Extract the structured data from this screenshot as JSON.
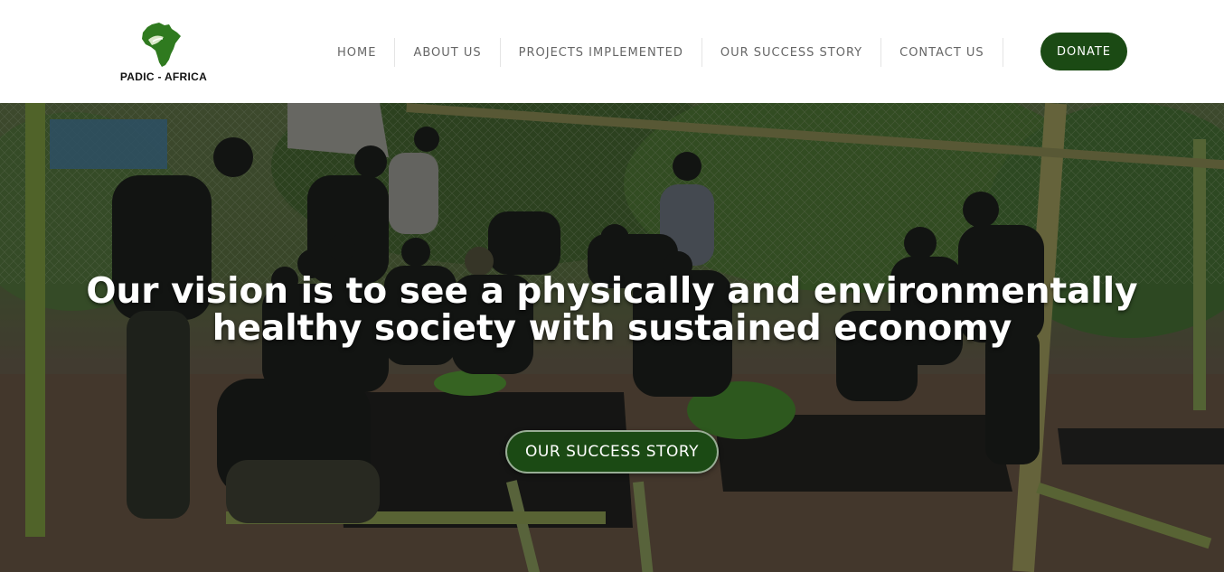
{
  "header": {
    "logo_text": "PADIC - AFRICA",
    "nav": [
      {
        "label": "HOME"
      },
      {
        "label": "ABOUT US"
      },
      {
        "label": "PROJECTS IMPLEMENTED"
      },
      {
        "label": "OUR SUCCESS STORY"
      },
      {
        "label": "CONTACT US"
      }
    ],
    "donate_label": "DONATE"
  },
  "hero": {
    "heading": "Our vision is to see a physically and environmentally healthy society with sustained economy",
    "cta_label": "OUR SUCCESS STORY"
  },
  "colors": {
    "brand_green": "#1b4a14",
    "nav_text": "#666666",
    "logo_green": "#2f7a1f"
  }
}
